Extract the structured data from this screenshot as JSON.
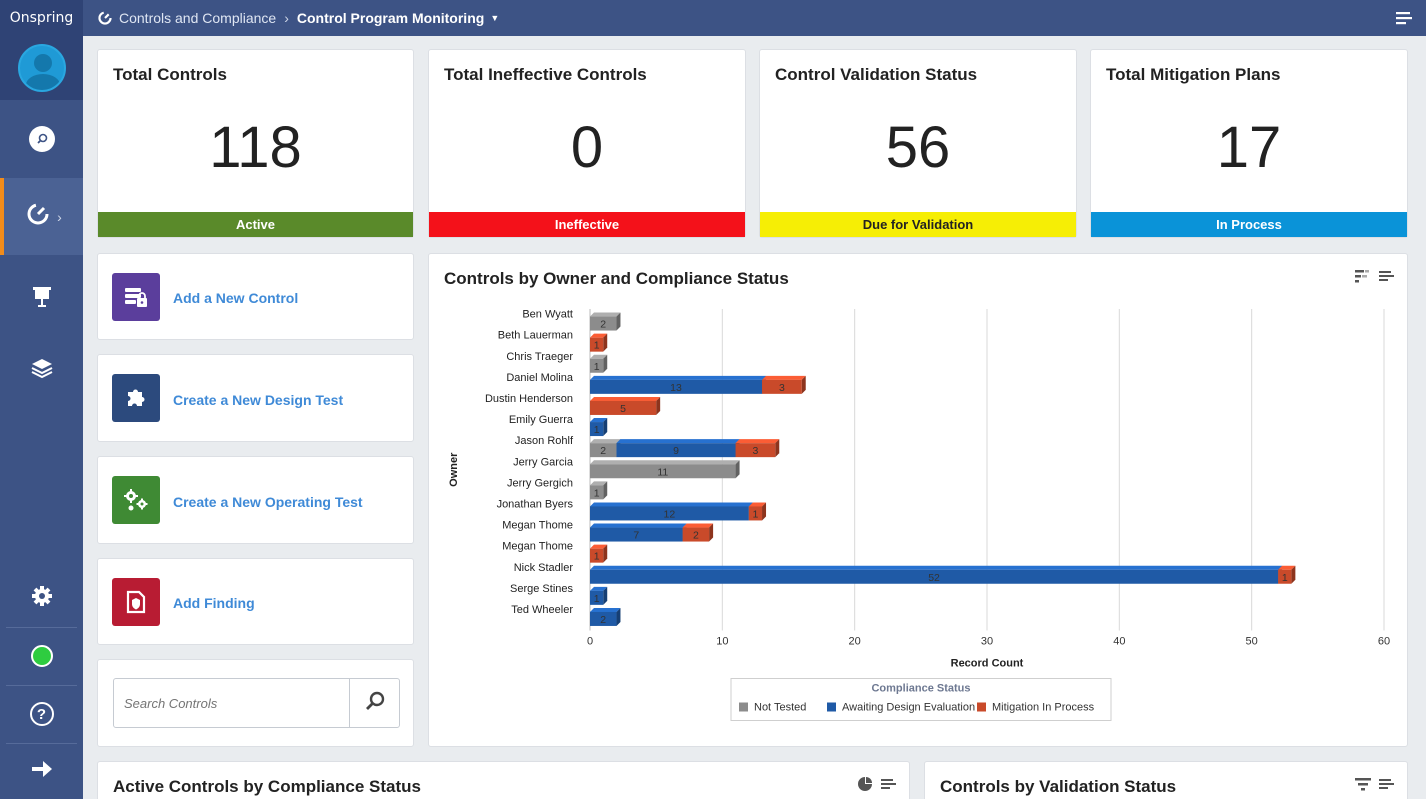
{
  "app": {
    "brand": "Onspring"
  },
  "breadcrumb": {
    "parent": "Controls and Compliance",
    "current": "Control Program Monitoring"
  },
  "stats": [
    {
      "title": "Total Controls",
      "value": "118",
      "status": "Active",
      "color": "#5a8a2a",
      "text_color": "#ffffff"
    },
    {
      "title": "Total Ineffective Controls",
      "value": "0",
      "status": "Ineffective",
      "color": "#f4111a",
      "text_color": "#ffffff"
    },
    {
      "title": "Control Validation Status",
      "value": "56",
      "status": "Due for Validation",
      "color": "#f6ee05",
      "text_color": "#222222"
    },
    {
      "title": "Total Mitigation Plans",
      "value": "17",
      "status": "In Process",
      "color": "#0a93d8",
      "text_color": "#ffffff"
    }
  ],
  "actions": [
    {
      "label": "Add a New Control",
      "icon": "server-lock-icon",
      "color": "#5b3e9c"
    },
    {
      "label": "Create a New Design Test",
      "icon": "puzzle-icon",
      "color": "#2c4a7d"
    },
    {
      "label": "Create a New Operating Test",
      "icon": "gears-icon",
      "color": "#3f8a34"
    },
    {
      "label": "Add Finding",
      "icon": "shield-doc-icon",
      "color": "#b81c33"
    }
  ],
  "search": {
    "placeholder": "Search Controls"
  },
  "panels": {
    "owner_chart_title": "Controls by Owner and Compliance Status",
    "active_controls_title": "Active Controls by Compliance Status",
    "validation_title": "Controls by Validation Status"
  },
  "chart_data": {
    "type": "bar",
    "orientation": "horizontal",
    "stacked": true,
    "title": "Controls by Owner and Compliance Status",
    "xlabel": "Record Count",
    "ylabel": "Owner",
    "xlim": [
      0,
      60
    ],
    "xticks": [
      0,
      10,
      20,
      30,
      40,
      50,
      60
    ],
    "grid": true,
    "legend_title": "Compliance Status",
    "legend_position": "bottom",
    "categories": [
      "Ben Wyatt",
      "Beth Lauerman",
      "Chris Traeger",
      "Daniel Molina",
      "Dustin Henderson",
      "Emily Guerra",
      "Jason Rohlf",
      "Jerry Garcia",
      "Jerry Gergich",
      "Jonathan Byers",
      "Megan Thome",
      "Megan Thome",
      "Nick Stadler",
      "Serge Stines",
      "Ted Wheeler"
    ],
    "series": [
      {
        "name": "Not Tested",
        "color": "#8c8c8c",
        "values": [
          2,
          0,
          1,
          0,
          0,
          0,
          2,
          11,
          1,
          0,
          0,
          0,
          0,
          0,
          0
        ]
      },
      {
        "name": "Awaiting Design Evaluation",
        "color": "#1f5aa6",
        "values": [
          0,
          0,
          0,
          13,
          0,
          1,
          9,
          0,
          0,
          12,
          7,
          0,
          52,
          1,
          2
        ]
      },
      {
        "name": "Mitigation In Process",
        "color": "#c94a2a",
        "values": [
          0,
          1,
          0,
          3,
          5,
          0,
          3,
          0,
          0,
          1,
          2,
          1,
          1,
          0,
          0
        ]
      }
    ]
  }
}
